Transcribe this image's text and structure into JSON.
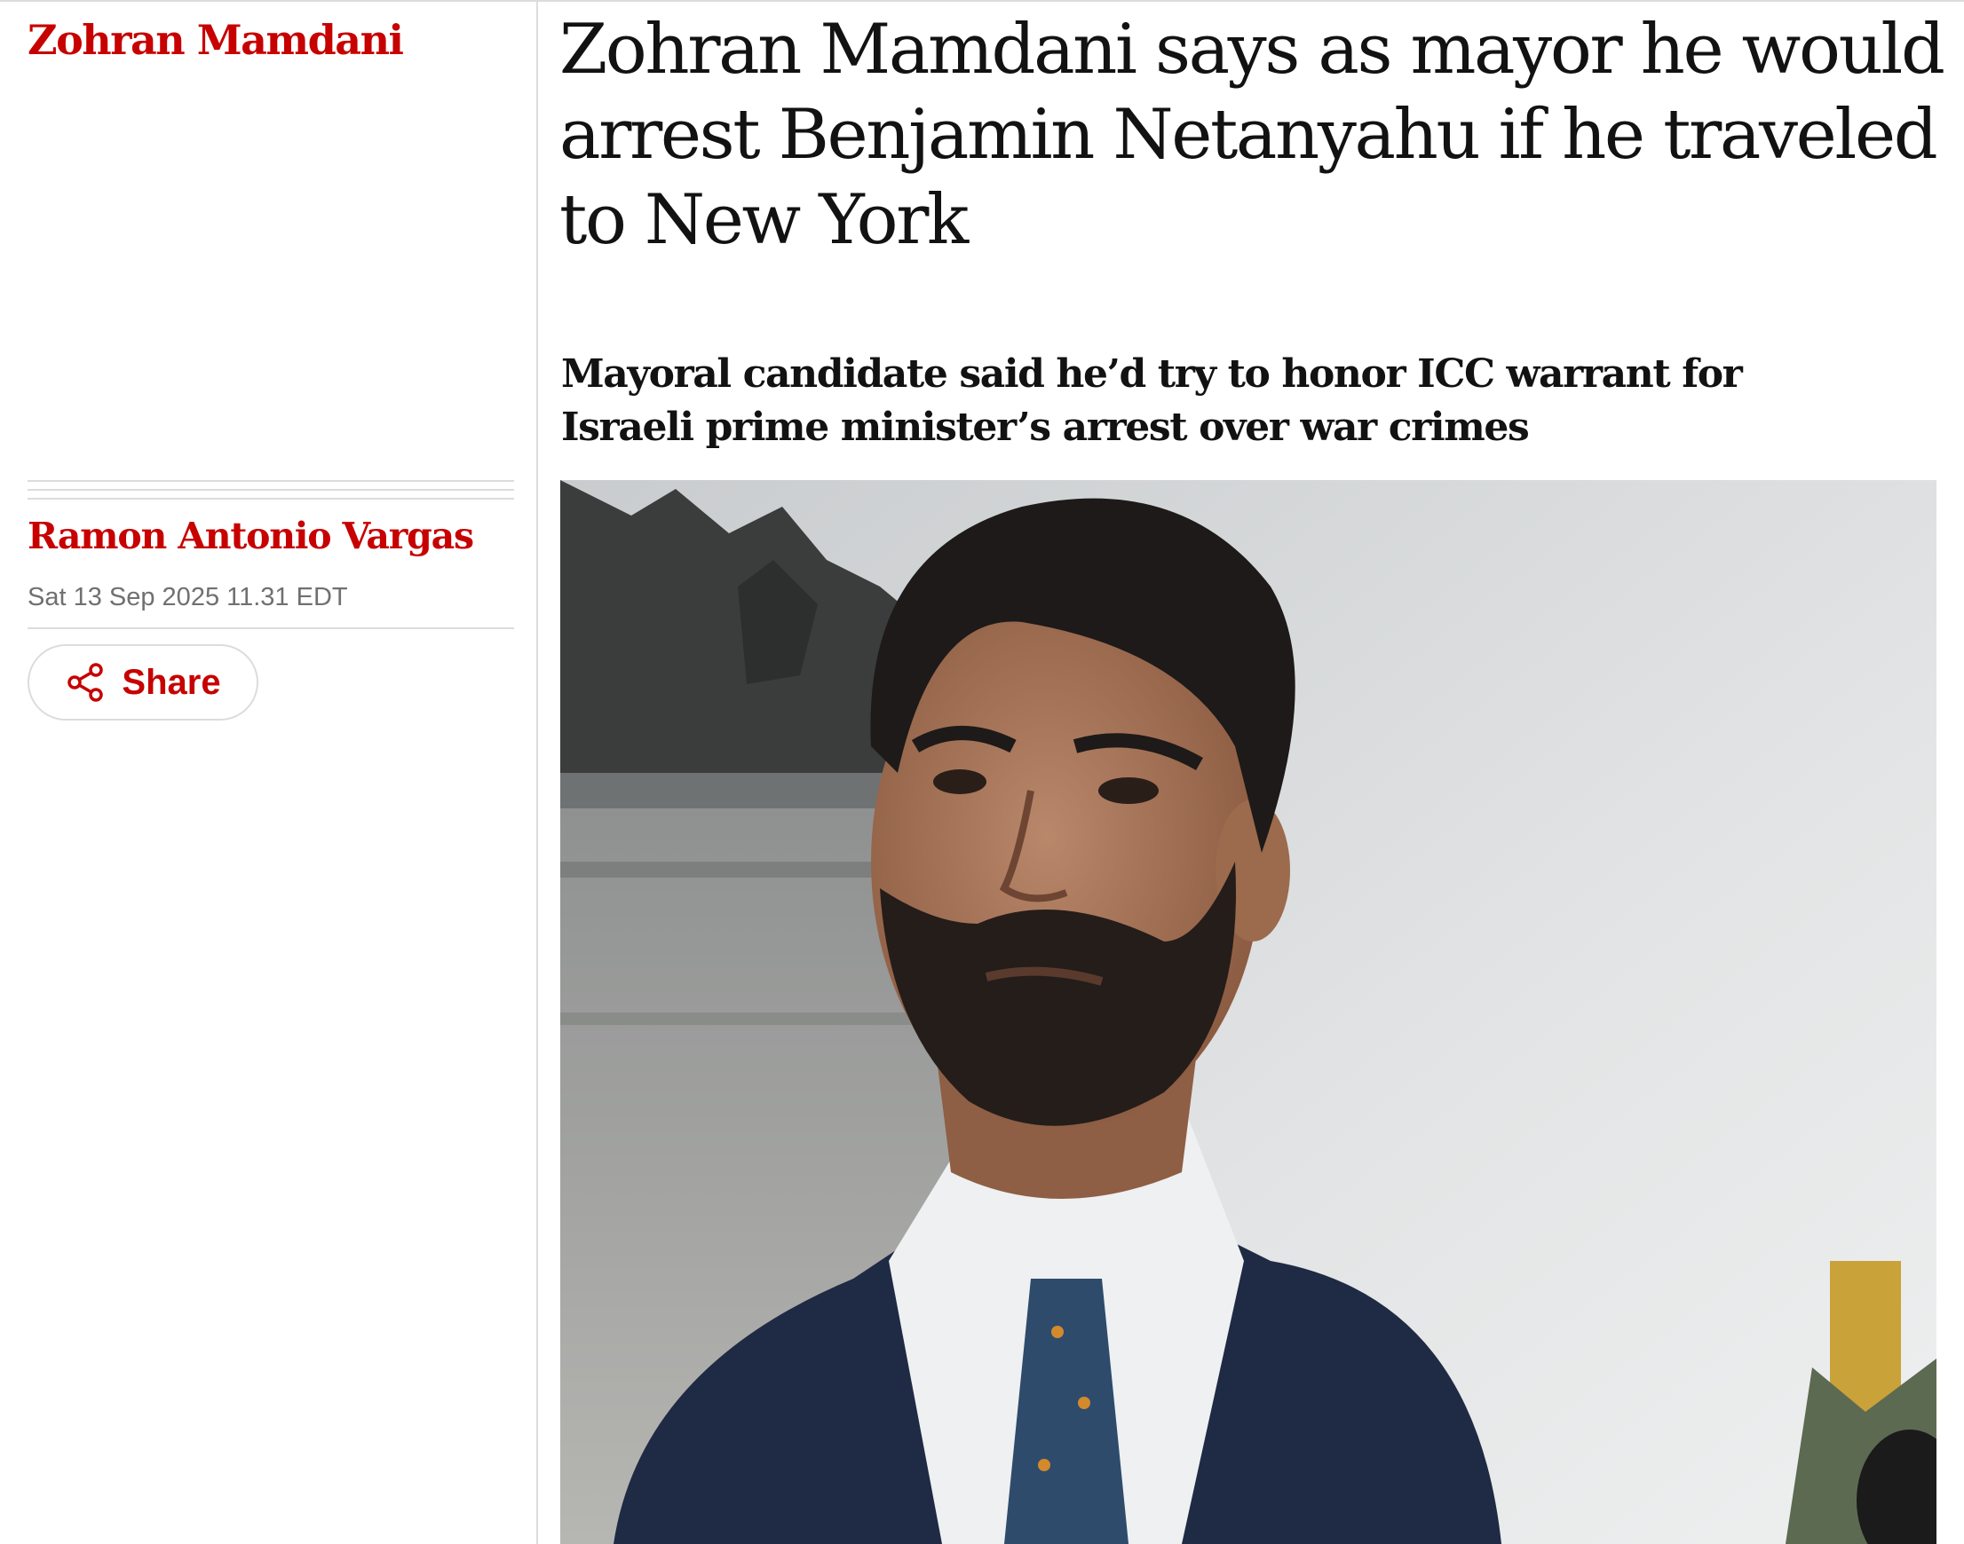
{
  "article": {
    "series": "Zohran Mamdani",
    "headline": "Zohran Mamdani says as mayor he would arrest Benjamin Netanyahu if he traveled to New York",
    "standfirst": "Mayoral candidate said he’d try to honor ICC warrant for Israeli prime minister’s arrest over war crimes",
    "byline": "Ramon Antonio Vargas",
    "dateline": "Sat 13 Sep 2025 11.31 EDT",
    "share_label": "Share"
  },
  "colors": {
    "accent": "#c70000",
    "text": "#121212",
    "muted": "#707070",
    "rule": "#dcdcdc"
  },
  "icons": {
    "share": "share-icon"
  }
}
